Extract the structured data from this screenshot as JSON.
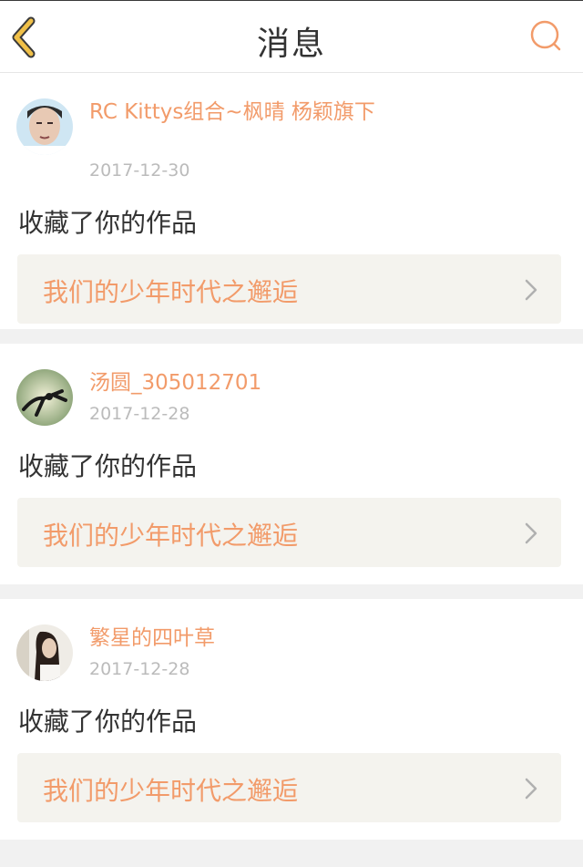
{
  "header": {
    "title": "消息",
    "back_icon": "chevron-left-icon",
    "search_icon": "search-icon",
    "accent_color": "#e8b84a",
    "search_color": "#f29b6a"
  },
  "messages": [
    {
      "username": "RC Kittys组合~枫晴 杨颖旗下",
      "date": "2017-12-30",
      "action": "收藏了你的作品",
      "work_title": "我们的少年时代之邂逅"
    },
    {
      "username": "汤圆_305012701",
      "date": "2017-12-28",
      "action": "收藏了你的作品",
      "work_title": "我们的少年时代之邂逅"
    },
    {
      "username": "繁星的四叶草",
      "date": "2017-12-28",
      "action": "收藏了你的作品",
      "work_title": "我们的少年时代之邂逅"
    }
  ],
  "colors": {
    "username": "#f29b6a",
    "date": "#bbbbbb",
    "work_bg": "#f4f3ee"
  }
}
